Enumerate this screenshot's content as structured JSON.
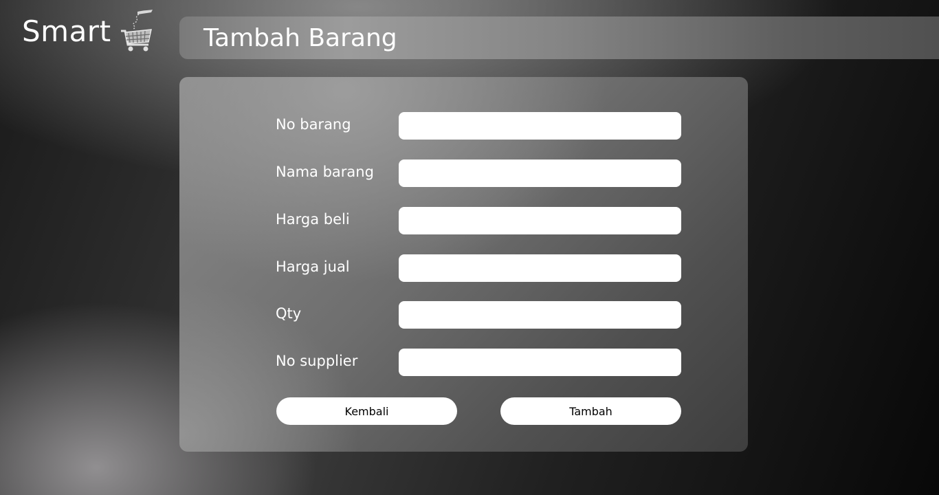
{
  "brand": {
    "name": "Smart",
    "icon": "shopping-cart-icon"
  },
  "header": {
    "title": "Tambah Barang"
  },
  "form": {
    "fields": [
      {
        "label": "No barang",
        "value": "",
        "placeholder": ""
      },
      {
        "label": "Nama barang",
        "value": "",
        "placeholder": ""
      },
      {
        "label": "Harga beli",
        "value": "",
        "placeholder": ""
      },
      {
        "label": "Harga jual",
        "value": "",
        "placeholder": ""
      },
      {
        "label": "Qty",
        "value": "",
        "placeholder": ""
      },
      {
        "label": "No supplier",
        "value": "",
        "placeholder": ""
      }
    ],
    "back_label": "Kembali",
    "submit_label": "Tambah"
  }
}
